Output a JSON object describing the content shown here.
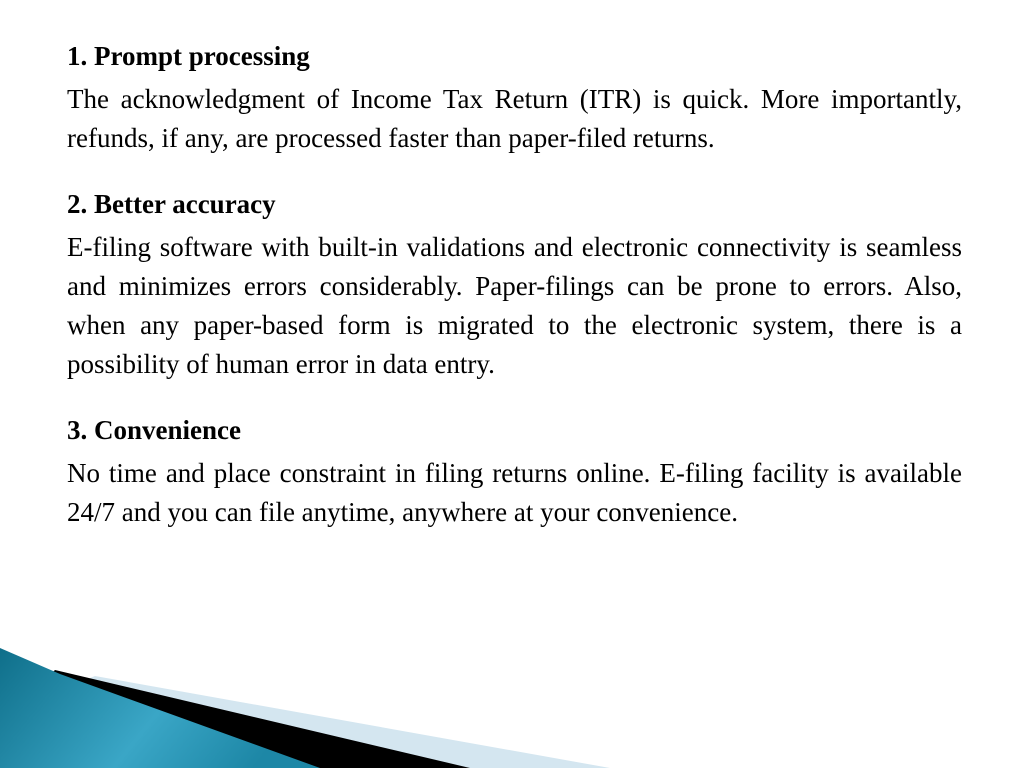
{
  "slide": {
    "sections": [
      {
        "title": "1. Prompt processing",
        "body": "The acknowledgment of Income Tax Return (ITR) is quick. More importantly, refunds, if any, are processed faster than paper-filed returns."
      },
      {
        "title": "2. Better accuracy",
        "body": "E-filing software with built-in validations and electronic connectivity is seamless and minimizes errors considerably. Paper-filings can be prone to errors. Also, when any paper-based form is migrated to the electronic system, there is a possibility of human error in data entry."
      },
      {
        "title": "3. Convenience",
        "body": "No time and place constraint in filing returns online. E-filing facility is available 24/7 and you can file anytime, anywhere at your convenience."
      }
    ]
  },
  "theme": {
    "teal_dark": "#0f6f8a",
    "teal_light": "#4fb3d0",
    "band_dark": "#000000",
    "band_light": "#d4e6f0"
  }
}
